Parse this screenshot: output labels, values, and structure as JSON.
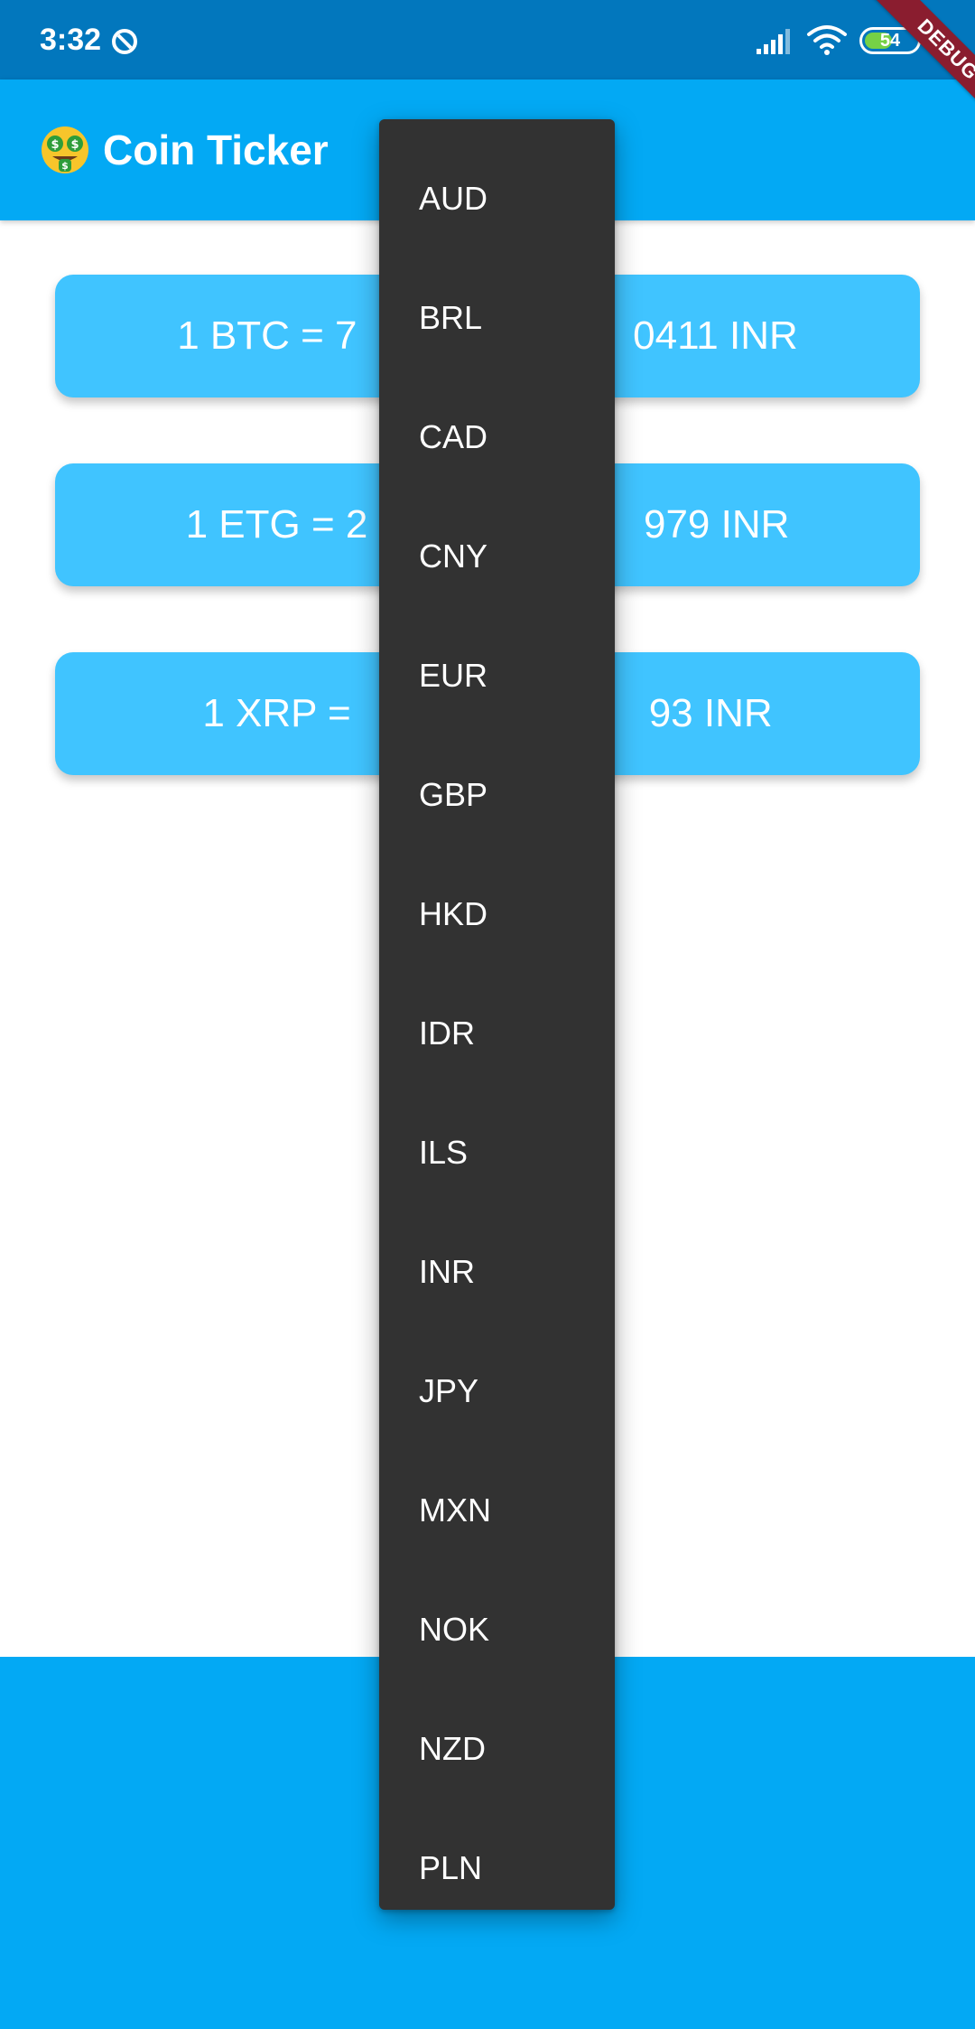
{
  "status_bar": {
    "time": "3:32",
    "battery": "54",
    "battery_level": 0.54,
    "icons": [
      "data-saver-icon",
      "signal-icon",
      "wifi-icon",
      "battery-icon"
    ]
  },
  "debug_banner": "DEBUG",
  "app_bar": {
    "emoji_icon": "money-mouth-face-icon",
    "title": "Coin Ticker"
  },
  "rates": [
    {
      "text": "1 BTC = 7                         0411 INR"
    },
    {
      "text": "1 ETG = 2                         979 INR"
    },
    {
      "text": "1 XRP =                           93 INR"
    }
  ],
  "currency_menu": [
    "AUD",
    "BRL",
    "CAD",
    "CNY",
    "EUR",
    "GBP",
    "HKD",
    "IDR",
    "ILS",
    "INR",
    "JPY",
    "MXN",
    "NOK",
    "NZD",
    "PLN"
  ],
  "colors": {
    "status_bar": "#0277bd",
    "app_bar": "#03a9f4",
    "card": "#40c4ff",
    "menu": "#323232",
    "debug_banner": "#8a1d2f"
  }
}
